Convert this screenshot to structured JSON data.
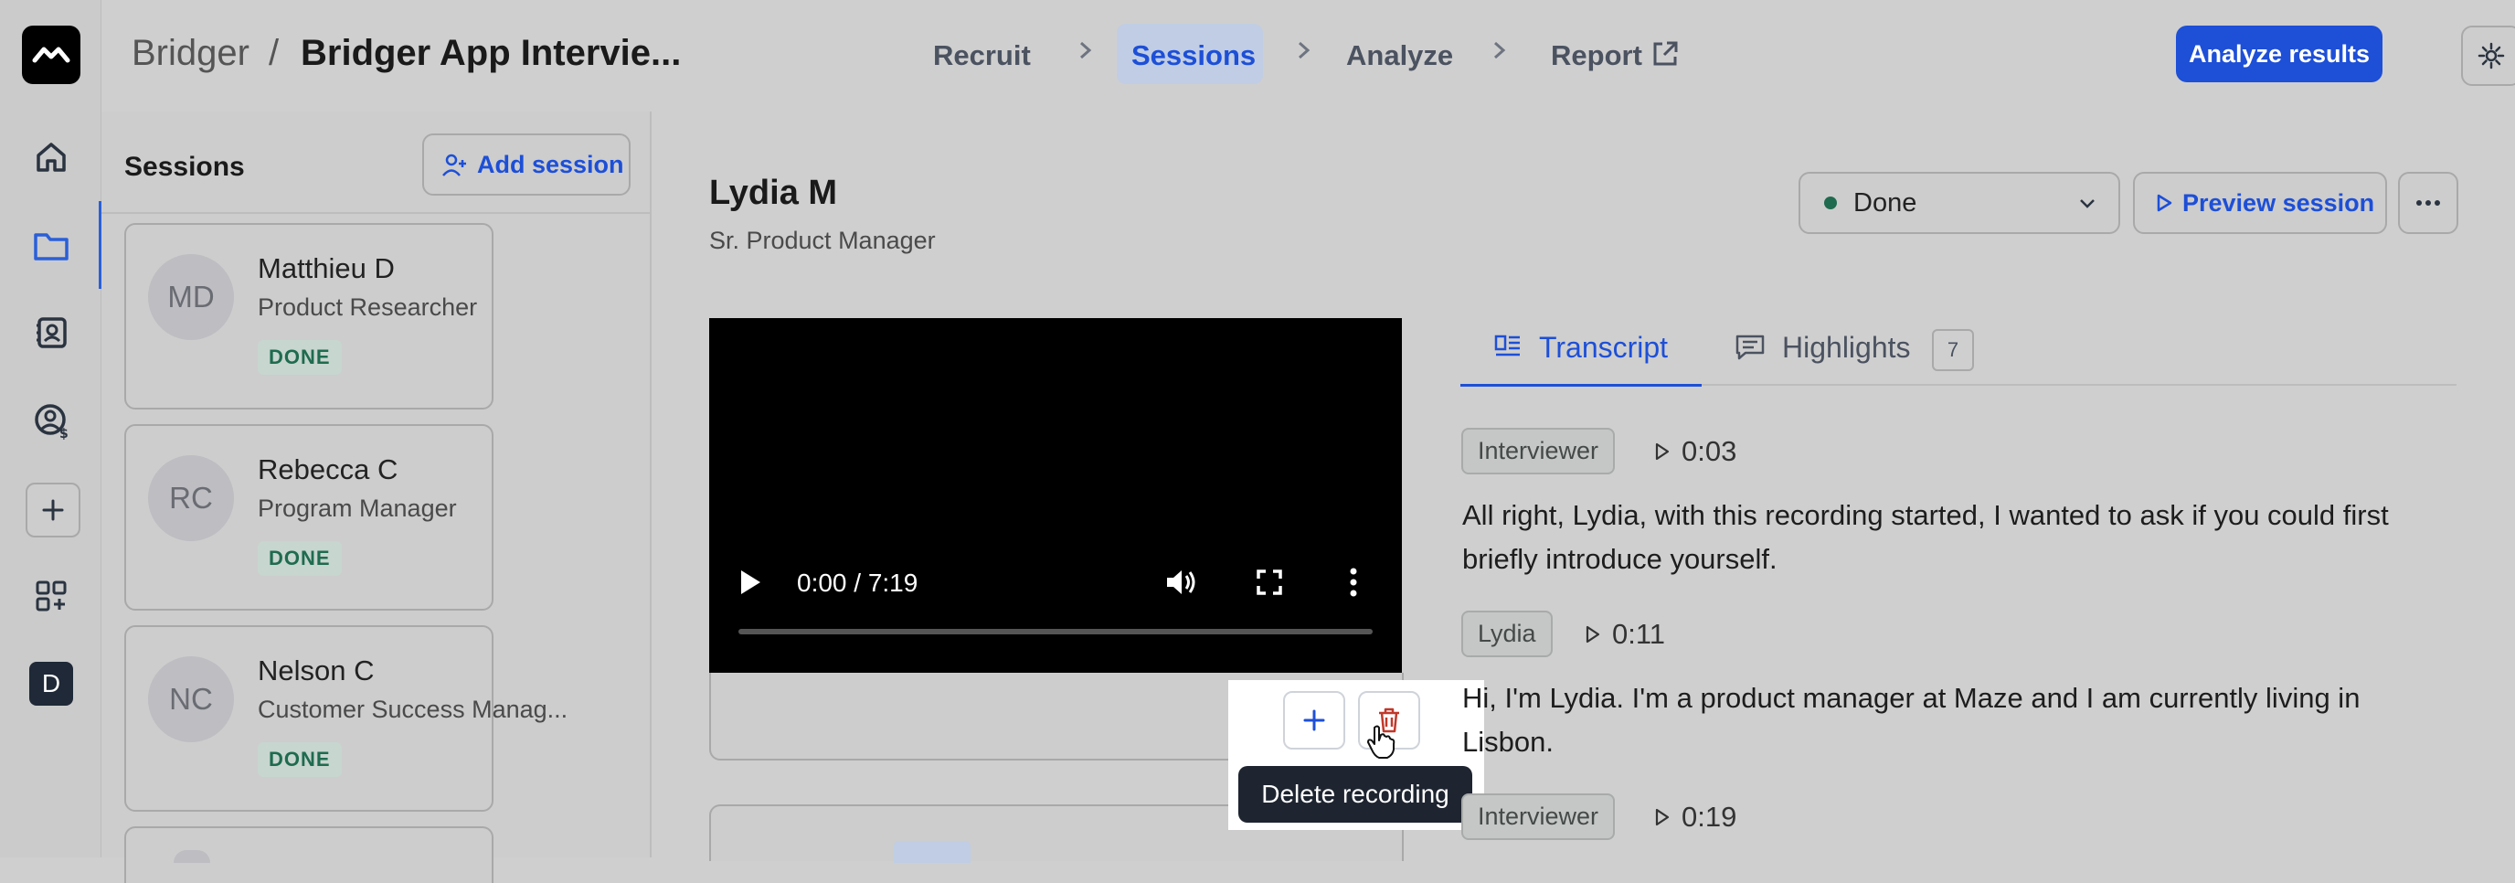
{
  "colors": {
    "accent": "#1d4fd7",
    "done_dot": "#1f6b4f",
    "delete_red": "#c0392b"
  },
  "rail": {
    "user_initial": "D",
    "icons": [
      "logo-icon",
      "home-icon",
      "folder-icon",
      "contacts-icon",
      "user-dollar-icon",
      "plus-icon",
      "apps-icon"
    ]
  },
  "header": {
    "workspace": "Bridger",
    "separator": "/",
    "project": "Bridger App Intervie...",
    "steps": [
      {
        "label": "Recruit"
      },
      {
        "label": "Sessions"
      },
      {
        "label": "Analyze"
      },
      {
        "label": "Report"
      }
    ],
    "analyze_button": "Analyze results"
  },
  "sessions": {
    "title": "Sessions",
    "add_button": "Add session",
    "items": [
      {
        "initials": "MD",
        "name": "Matthieu D",
        "role": "Product Researcher",
        "status": "DONE"
      },
      {
        "initials": "RC",
        "name": "Rebecca C",
        "role": "Program Manager",
        "status": "DONE"
      },
      {
        "initials": "NC",
        "name": "Nelson C",
        "role": "Customer Success Manag...",
        "status": "DONE"
      }
    ]
  },
  "session": {
    "name": "Lydia M",
    "title": "Sr. Product Manager",
    "status": "Done",
    "preview_button": "Preview session"
  },
  "video": {
    "time": "0:00 / 7:19",
    "progress": 0
  },
  "tooltip": {
    "label": "Delete recording"
  },
  "tabs": {
    "transcript": "Transcript",
    "highlights": "Highlights",
    "highlights_count": "7"
  },
  "transcript": [
    {
      "speaker": "Interviewer",
      "time": "0:03",
      "text": "All right, Lydia, with this recording started, I wanted to ask if you could first briefly introduce yourself."
    },
    {
      "speaker": "Lydia",
      "time": "0:11",
      "text": "Hi, I'm Lydia. I'm a product manager at Maze and I am currently living in Lisbon."
    },
    {
      "speaker": "Interviewer",
      "time": "0:19",
      "text": ""
    }
  ]
}
